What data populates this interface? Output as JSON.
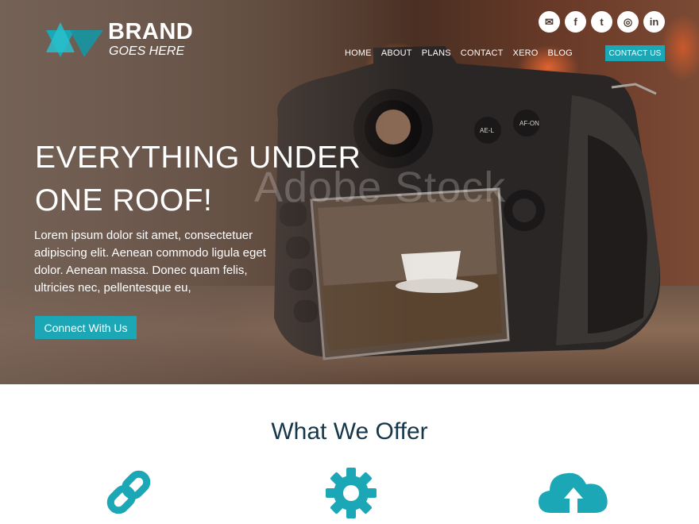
{
  "colors": {
    "accent": "#1ba7b5",
    "heading": "#16364a",
    "white": "#ffffff"
  },
  "brand": {
    "name": "BRAND",
    "tagline": "GOES HERE"
  },
  "social": [
    {
      "name": "email-icon",
      "glyph": "✉"
    },
    {
      "name": "facebook-icon",
      "glyph": "f"
    },
    {
      "name": "twitter-icon",
      "glyph": "t"
    },
    {
      "name": "instagram-icon",
      "glyph": "◎"
    },
    {
      "name": "linkedin-icon",
      "glyph": "in"
    }
  ],
  "nav": {
    "items": [
      "HOME",
      "ABOUT",
      "PLANS",
      "CONTACT",
      "XERO",
      "BLOG"
    ],
    "contact_label": "CONTACT US"
  },
  "hero": {
    "headline_line1": "EVERYTHING UNDER",
    "headline_line2": "ONE ROOF!",
    "body": "Lorem ipsum dolor sit amet, consectetuer adipiscing elit. Aenean commodo ligula eget dolor. Aenean massa. Donec quam felis, ultricies nec, pellentesque eu,",
    "cta_label": "Connect With Us",
    "watermark": "Adobe Stock"
  },
  "offer": {
    "title": "What We Offer",
    "icons": [
      "link-icon",
      "gear-icon",
      "cloud-upload-icon"
    ]
  }
}
